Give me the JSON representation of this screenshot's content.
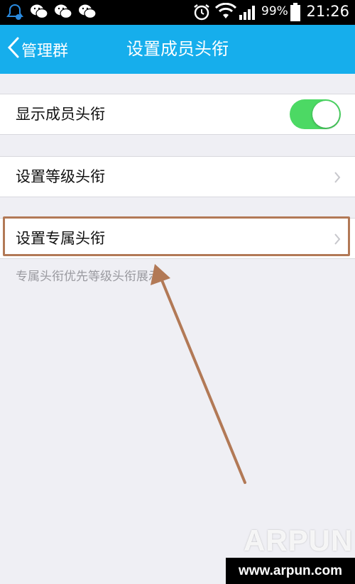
{
  "status_bar": {
    "battery_percent": "99%",
    "time": "21:26",
    "icons": [
      "qq-notification-icon",
      "wechat-icon",
      "wechat-icon",
      "wechat-icon",
      "alarm-icon",
      "wifi-icon",
      "signal-icon",
      "battery-icon"
    ]
  },
  "navbar": {
    "back_label": "管理群",
    "title": "设置成员头衔"
  },
  "settings": {
    "show_titles": {
      "label": "显示成员头衔",
      "enabled": true
    },
    "level_titles": {
      "label": "设置等级头衔"
    },
    "exclusive_titles": {
      "label": "设置专属头衔"
    },
    "footnote": "专属头衔优先等级头衔展示"
  },
  "annotation": {
    "highlight_color": "#b27956",
    "arrow_color": "#b27956"
  },
  "watermark": {
    "brand": "ARPUN",
    "url": "www.arpun.com"
  },
  "colors": {
    "navbar": "#16aeec",
    "toggle_on": "#4cd964",
    "background": "#efeff4"
  }
}
